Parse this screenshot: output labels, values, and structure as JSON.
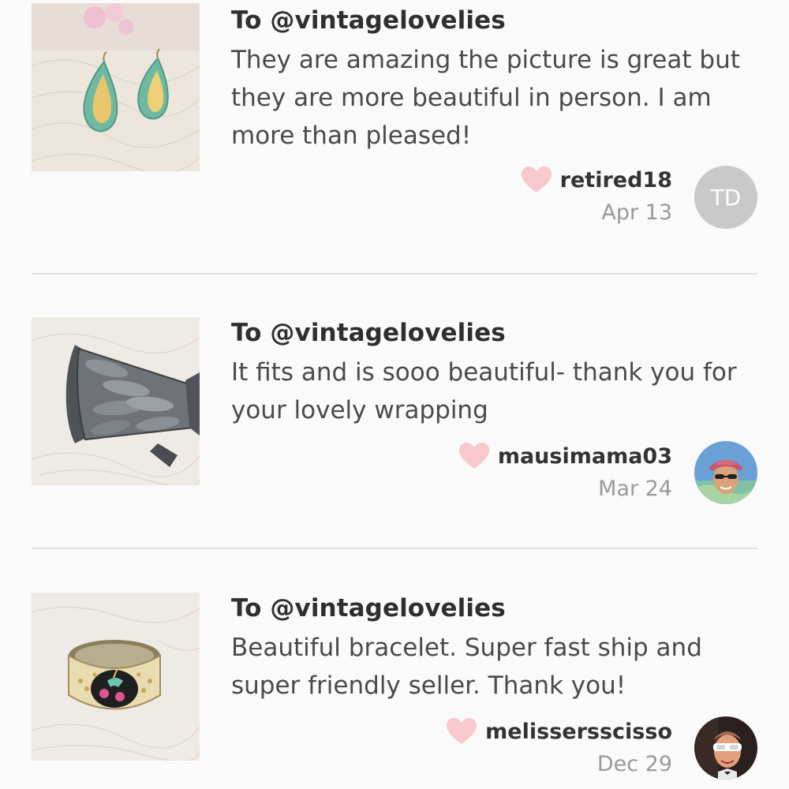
{
  "reviews": [
    {
      "to": "To @vintagelovelies",
      "comment": "They are amazing the picture is great but they are more beautiful in person. I am more than pleased!",
      "username": "retired18",
      "date": "Apr 13",
      "avatar_initials": "TD",
      "product_image": "teardrop-earrings"
    },
    {
      "to": "To @vintagelovelies",
      "comment": "It fits and is sooo beautiful- thank you for your lovely wrapping",
      "username": "mausimama03",
      "date": "Mar 24",
      "avatar_initials": "",
      "product_image": "silver-cuff-bracelet"
    },
    {
      "to": "To @vintagelovelies",
      "comment": "Beautiful bracelet. Super fast ship and super friendly seller. Thank you!",
      "username": "melissersscisso",
      "date": "Dec 29",
      "avatar_initials": "",
      "product_image": "bangle-bracelet"
    }
  ],
  "colors": {
    "background": "#fbfafb",
    "heart": "#f7c9cd",
    "divider": "#e3e1e3",
    "date": "#9a9a9a",
    "avatar_placeholder": "#c9c9c9"
  },
  "icons": [
    "heart-icon"
  ]
}
